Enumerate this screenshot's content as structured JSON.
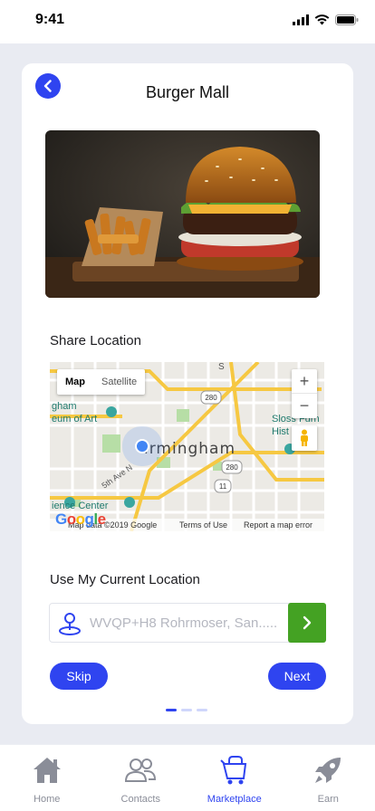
{
  "status_bar": {
    "time": "9:41"
  },
  "header": {
    "title": "Burger Mall"
  },
  "share_location": {
    "label": "Share Location",
    "map": {
      "type_options": [
        "Map",
        "Satellite"
      ],
      "selected_type": "Map",
      "zoom_in": "+",
      "zoom_out": "−",
      "city_label": "irmingham",
      "poi_labels": [
        "gham",
        "eum of Art",
        "Sloss Furn",
        "Hist  La",
        "5th Ave N",
        "ience Center"
      ],
      "route_shields": [
        "280",
        "280",
        "11"
      ],
      "street_label": "S",
      "logo": "Google",
      "attribution": "Map data ©2019 Google",
      "terms": "Terms of Use",
      "report": "Report a map error"
    }
  },
  "current_location": {
    "label": "Use My Current Location",
    "placeholder": "WVQP+H8 Rohrmoser, San....."
  },
  "actions": {
    "skip": "Skip",
    "next": "Next"
  },
  "pager": {
    "count": 3,
    "active_index": 0
  },
  "tabbar": {
    "items": [
      {
        "label": "Home",
        "icon": "home-icon"
      },
      {
        "label": "Contacts",
        "icon": "contacts-icon"
      },
      {
        "label": "Marketplace",
        "icon": "marketplace-cart-icon"
      },
      {
        "label": "Earn",
        "icon": "rocket-icon"
      }
    ],
    "active": "Marketplace"
  },
  "colors": {
    "accent": "#2f44f0",
    "go_button": "#44a223",
    "background": "#e9ebf2"
  }
}
